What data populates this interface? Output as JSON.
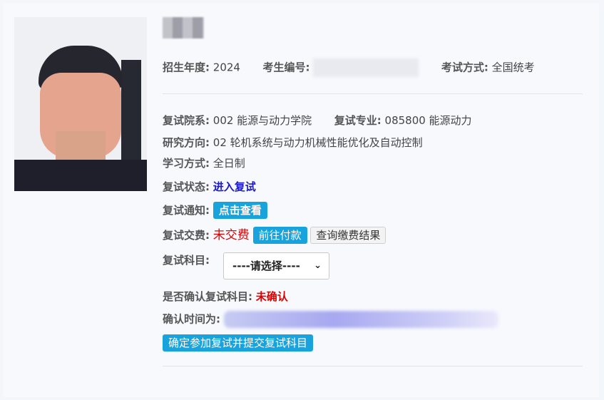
{
  "profile": {
    "year_label": "招生年度:",
    "year_value": "2024",
    "examinee_label": "考生编号:",
    "exam_method_label": "考试方式:",
    "exam_method_value": "全国统考"
  },
  "details": {
    "college_label": "复试院系:",
    "college_value": "002 能源与动力学院",
    "major_label": "复试专业:",
    "major_value": "085800 能源动力",
    "direction_label": "研究方向:",
    "direction_value": "02 轮机系统与动力机械性能优化及自动控制",
    "study_mode_label": "学习方式:",
    "study_mode_value": "全日制",
    "status_label": "复试状态:",
    "status_value": "进入复试",
    "notice_label": "复试通知:",
    "notice_button": "点击查看",
    "fee_label": "复试交费:",
    "fee_status": "未交费",
    "pay_button": "前往付款",
    "query_button": "查询缴费结果",
    "subject_label": "复试科目:",
    "subject_select": "----请选择----",
    "confirm_label": "是否确认复试科目:",
    "confirm_value": "未确认",
    "confirm_time_label": "确认时间为:",
    "submit_button": "确定参加复试并提交复试科目"
  },
  "colors": {
    "accent_blue": "#19a3dc",
    "status_blue": "#1a1acc",
    "status_red": "#e00000"
  },
  "icons": {
    "select_chevron": "chevron-down-icon"
  }
}
